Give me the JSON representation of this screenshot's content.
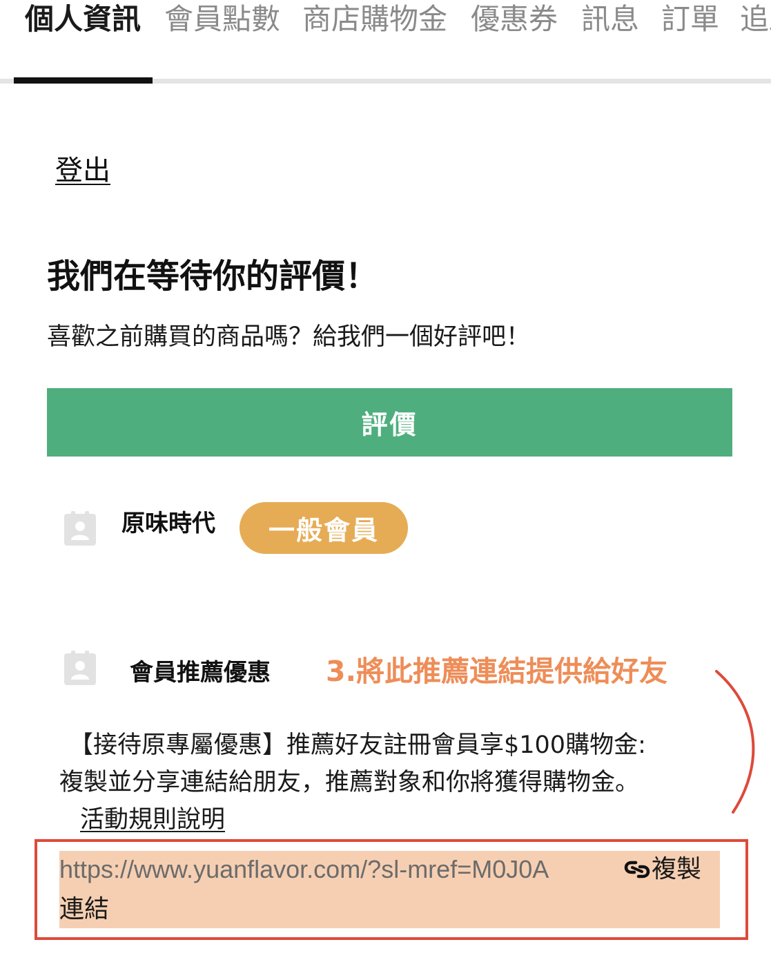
{
  "tabs": [
    {
      "label": "個人資訊",
      "active": true
    },
    {
      "label": "會員點數",
      "active": false
    },
    {
      "label": "商店購物金",
      "active": false
    },
    {
      "label": "優惠券",
      "active": false
    },
    {
      "label": "訊息",
      "active": false
    },
    {
      "label": "訂單",
      "active": false
    },
    {
      "label": "追蹤",
      "active": false
    }
  ],
  "logout_label": "登出",
  "review": {
    "title": "我們在等待你的評價！",
    "subtitle": "喜歡之前購買的商品嗎？給我們一個好評吧！",
    "button_label": "評價"
  },
  "member": {
    "name": "原味時代",
    "tier": "一般會員",
    "avatar_icon": "person-icon"
  },
  "referral": {
    "title": "會員推薦優惠",
    "annotation": "3.將此推薦連結提供給好友",
    "description_line1": "【接待原專屬優惠】推薦好友註冊會員享$100購物金:",
    "description_line2": "複製並分享連結給朋友，推薦對象和你將獲得購物金。",
    "rules_link": "活動規則說明",
    "url": "https://www.yuanflavor.com/?sl-mref=M0J0A",
    "copy_label_part1": "複製",
    "copy_label_part2": "連結",
    "copy_icon": "link-icon"
  },
  "colors": {
    "review_button": "#4fae7e",
    "tier_badge": "#e6ac55",
    "annotation": "#ee8d58",
    "annotation_frame": "#dd4a3a",
    "link_background": "#f6cfb2"
  }
}
